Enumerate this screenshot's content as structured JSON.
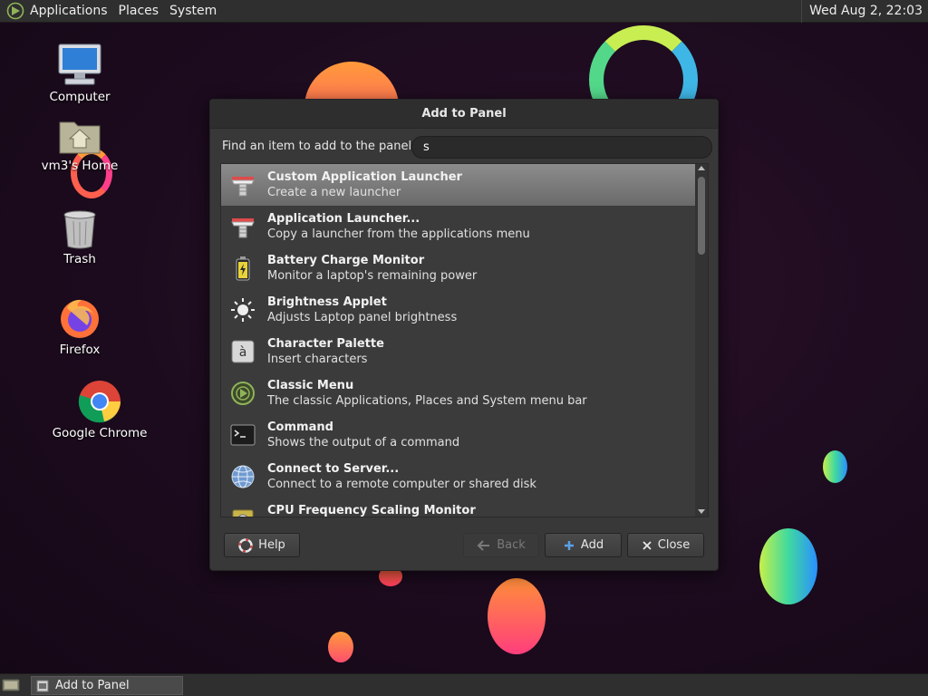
{
  "top_panel": {
    "menus": [
      "Applications",
      "Places",
      "System"
    ],
    "clock": "Wed Aug  2, 22:03"
  },
  "desktop_icons": [
    {
      "label": "Computer",
      "icon": "computer-icon"
    },
    {
      "label": "vm3's Home",
      "icon": "home-folder-icon"
    },
    {
      "label": "Trash",
      "icon": "trash-icon"
    },
    {
      "label": "Firefox",
      "icon": "firefox-icon"
    },
    {
      "label": "Google Chrome",
      "icon": "chrome-icon"
    }
  ],
  "dialog": {
    "title": "Add to Panel",
    "find_label": "Find an item to add to the panel:",
    "find_value": "s",
    "items": [
      {
        "title": "Custom Application Launcher",
        "desc": "Create a new launcher",
        "icon": "launcher-icon",
        "selected": true
      },
      {
        "title": "Application Launcher...",
        "desc": "Copy a launcher from the applications menu",
        "icon": "launcher-icon",
        "selected": false
      },
      {
        "title": "Battery Charge Monitor",
        "desc": "Monitor a laptop's remaining power",
        "icon": "battery-icon",
        "selected": false
      },
      {
        "title": "Brightness Applet",
        "desc": "Adjusts Laptop panel brightness",
        "icon": "brightness-icon",
        "selected": false
      },
      {
        "title": "Character Palette",
        "desc": "Insert characters",
        "icon": "character-palette-icon",
        "selected": false
      },
      {
        "title": "Classic Menu",
        "desc": "The classic Applications, Places and System menu bar",
        "icon": "classic-menu-icon",
        "selected": false
      },
      {
        "title": "Command",
        "desc": "Shows the output of a command",
        "icon": "terminal-icon",
        "selected": false
      },
      {
        "title": "Connect to Server...",
        "desc": "Connect to a remote computer or shared disk",
        "icon": "globe-icon",
        "selected": false
      },
      {
        "title": "CPU Frequency Scaling Monitor",
        "desc": "",
        "icon": "cpu-icon",
        "selected": false
      }
    ],
    "buttons": {
      "help": "Help",
      "back": "Back",
      "add": "Add",
      "close": "Close"
    }
  },
  "taskbar": {
    "task_label": "Add to Panel"
  }
}
